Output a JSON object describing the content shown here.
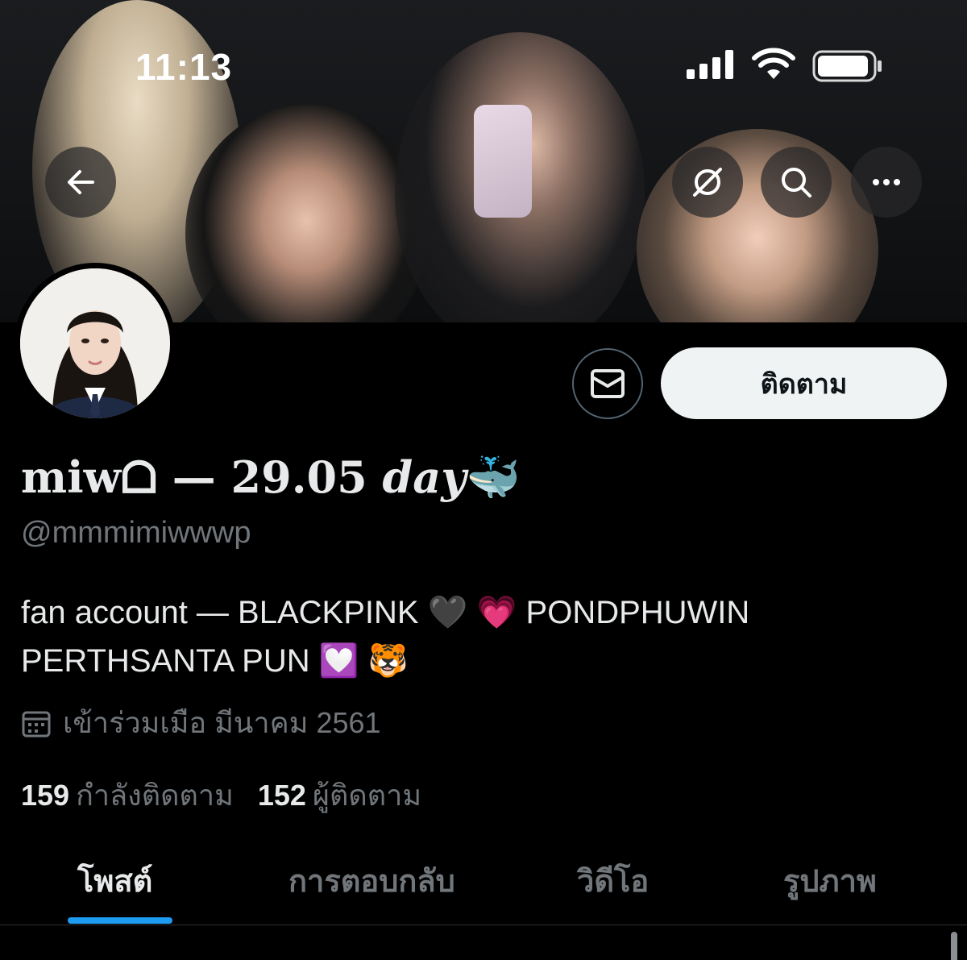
{
  "status_bar": {
    "time": "11:13"
  },
  "nav": {
    "back_icon": "arrow-left-icon",
    "hide_icon": "eye-slash-icon",
    "search_icon": "search-icon",
    "more_icon": "more-horizontal-icon"
  },
  "profile": {
    "display_name_part1": "miwᗝ — 29.05 ",
    "display_name_part2": "day",
    "display_name_emoji": "🐳",
    "handle": "@mmmimiwwwp",
    "bio_line1": "fan account — BLACKPINK 🖤 💗  PONDPHUWIN",
    "bio_line2": "PERTHSANTA PUN 💟 🐯",
    "joined": "เข้าร่วมเมือ มีนาคม 2561",
    "following_count": "159",
    "following_label": "กำลังติดตาม",
    "followers_count": "152",
    "followers_label": "ผู้ติดตาม"
  },
  "actions": {
    "message_icon": "envelope-icon",
    "follow_label": "ติดตาม"
  },
  "tabs": [
    {
      "label": "โพสต์",
      "active": true
    },
    {
      "label": "การตอบกลับ",
      "active": false
    },
    {
      "label": "วิดีโอ",
      "active": false
    },
    {
      "label": "รูปภาพ",
      "active": false
    }
  ],
  "colors": {
    "accent": "#1d9bf0",
    "background": "#000000",
    "secondary_text": "#71767b"
  }
}
